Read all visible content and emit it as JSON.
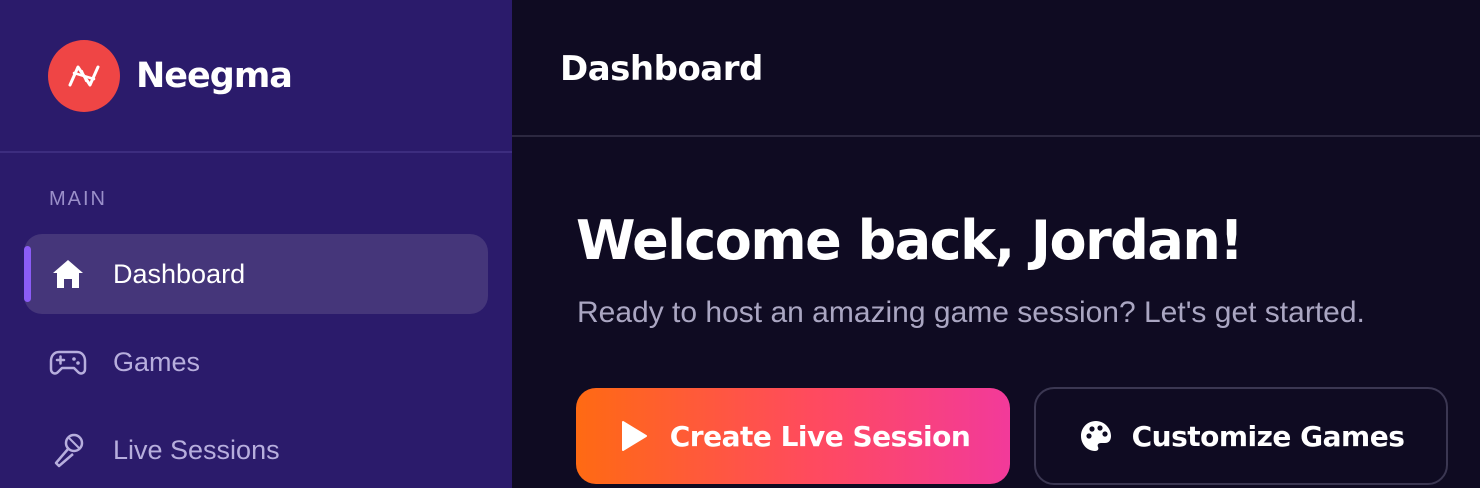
{
  "brand": {
    "name": "Neegma"
  },
  "sidebar": {
    "section_label": "MAIN",
    "items": [
      {
        "label": "Dashboard",
        "icon": "home-icon",
        "active": true
      },
      {
        "label": "Games",
        "icon": "gamepad-icon",
        "active": false
      },
      {
        "label": "Live Sessions",
        "icon": "microphone-icon",
        "active": false
      }
    ]
  },
  "header": {
    "title": "Dashboard"
  },
  "main": {
    "welcome": "Welcome back, Jordan!",
    "subtitle": "Ready to host an amazing game session? Let's get started.",
    "primary_button": {
      "label": "Create Live Session",
      "icon": "play-icon"
    },
    "secondary_button": {
      "label": "Customize Games",
      "icon": "palette-icon"
    }
  },
  "colors": {
    "sidebar_bg": "#2b1b6b",
    "main_bg": "#0f0b22",
    "accent": "#8b5cf6",
    "logo_bg": "#ef4545",
    "gradient_start": "#ff6a13",
    "gradient_end": "#f23a9a"
  }
}
